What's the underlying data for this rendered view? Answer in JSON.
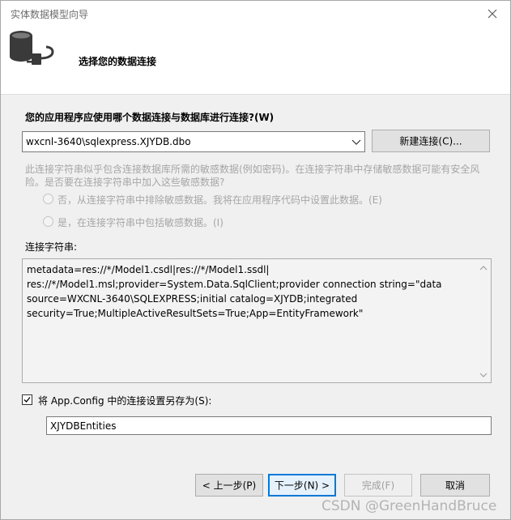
{
  "window": {
    "title": "实体数据模型向导"
  },
  "header": {
    "title": "选择您的数据连接",
    "icon": "database-plug-icon"
  },
  "connection": {
    "question": "您的应用程序应使用哪个数据连接与数据库进行连接?(W)",
    "selected": "wxcnl-3640\\sqlexpress.XJYDB.dbo",
    "new_connection_label": "新建连接(C)..."
  },
  "sensitive": {
    "notice": "此连接字符串似乎包含连接数据库所需的敏感数据(例如密码)。在连接字符串中存储敏感数据可能有安全风险。是否要在连接字符串中加入这些敏感数据?",
    "option_no": "否，从连接字符串中排除敏感数据。我将在应用程序代码中设置此数据。(E)",
    "option_yes": "是，在连接字符串中包括敏感数据。(I)"
  },
  "connection_string": {
    "label": "连接字符串:",
    "value": "metadata=res://*/Model1.csdl|res://*/Model1.ssdl|\nres://*/Model1.msl;provider=System.Data.SqlClient;provider connection string=\"data\nsource=WXCNL-3640\\SQLEXPRESS;initial catalog=XJYDB;integrated\nsecurity=True;MultipleActiveResultSets=True;App=EntityFramework\""
  },
  "save": {
    "checked": true,
    "label": "将 App.Config 中的连接设置另存为(S):",
    "value": "XJYDBEntities"
  },
  "footer": {
    "back": "< 上一步(P)",
    "next": "下一步(N) >",
    "finish": "完成(F)",
    "cancel": "取消"
  },
  "watermark": "CSDN @GreenHandBruce"
}
